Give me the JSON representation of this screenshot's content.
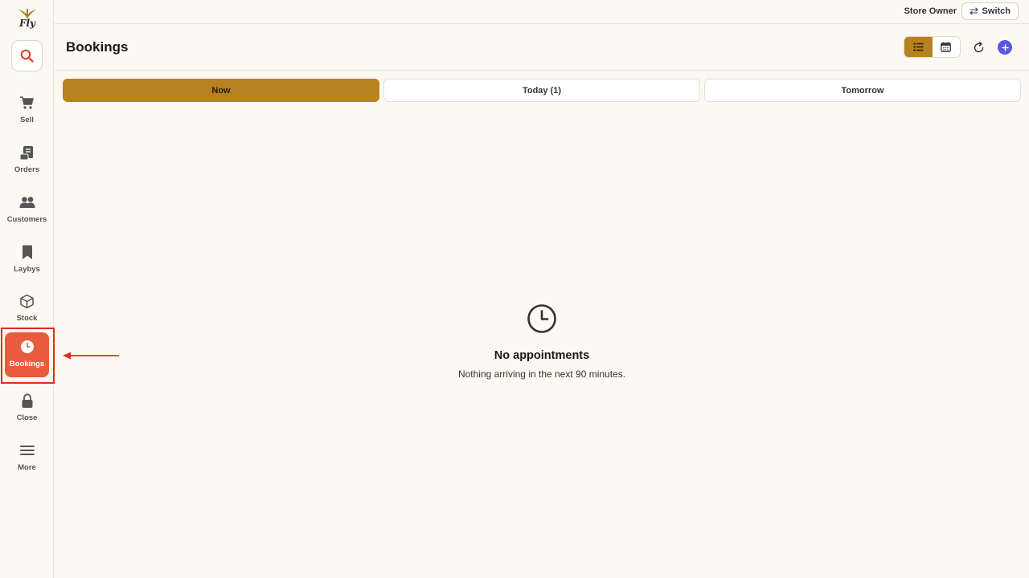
{
  "app": {
    "logo_text": "Fly"
  },
  "topbar": {
    "user_role": "Store Owner",
    "switch_label": "Switch"
  },
  "header": {
    "title": "Bookings"
  },
  "sidebar": {
    "items": [
      {
        "label": "Sell",
        "icon": "cart-icon"
      },
      {
        "label": "Orders",
        "icon": "receipt-icon"
      },
      {
        "label": "Customers",
        "icon": "users-icon"
      },
      {
        "label": "Laybys",
        "icon": "bookmark-icon"
      },
      {
        "label": "Stock",
        "icon": "box-icon"
      },
      {
        "label": "Bookings",
        "icon": "clock-icon",
        "active": true
      },
      {
        "label": "Close",
        "icon": "lock-icon"
      },
      {
        "label": "More",
        "icon": "menu-icon"
      }
    ]
  },
  "tabs": [
    {
      "label": "Now",
      "active": true
    },
    {
      "label": "Today (1)"
    },
    {
      "label": "Tomorrow"
    }
  ],
  "empty_state": {
    "title": "No appointments",
    "message": "Nothing arriving in the next 90 minutes."
  },
  "colors": {
    "accent": "#b8811f",
    "active_nav": "#e85b3c",
    "add_button": "#5b57e0",
    "annotation": "#e02b1c"
  }
}
